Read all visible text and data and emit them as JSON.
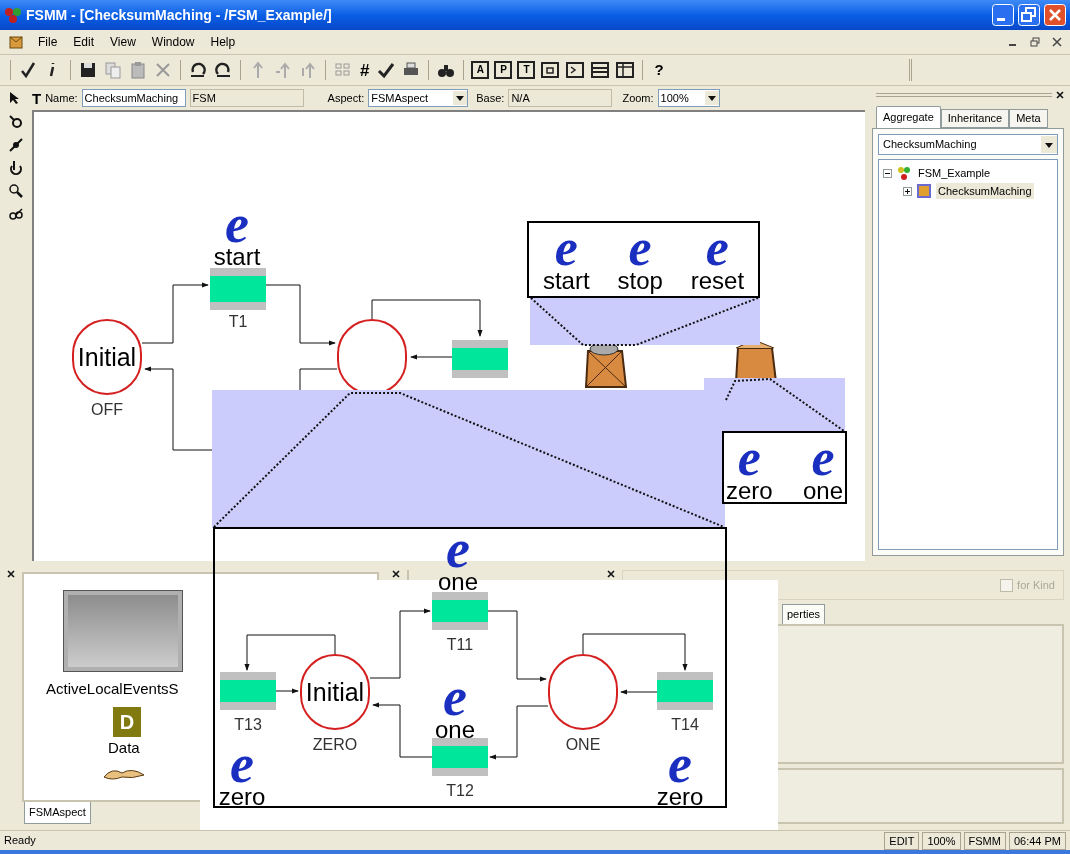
{
  "window": {
    "title": "FSMM - [ChecksumMaching - /FSM_Example/]"
  },
  "menu": [
    "File",
    "Edit",
    "View",
    "Window",
    "Help"
  ],
  "toolbar": {
    "grid_button": "#",
    "view_buttons": [
      "A",
      "P",
      "T"
    ],
    "help_button": "?"
  },
  "name_bar": {
    "tool_letter": "T",
    "name_label": "Name:",
    "name_value": "ChecksumMaching",
    "kind_value": "FSM",
    "aspect_label": "Aspect:",
    "aspect_value": "FSMAspect",
    "base_label": "Base:",
    "base_value": "N/A",
    "zoom_label": "Zoom:",
    "zoom_value": "100%"
  },
  "browser": {
    "tabs": [
      {
        "label": "Aggregate",
        "selected": true
      },
      {
        "label": "Inheritance",
        "selected": false
      },
      {
        "label": "Meta",
        "selected": false
      }
    ],
    "filter_value": "ChecksumMaching",
    "tree": [
      {
        "label": "FSM_Example",
        "expanded": true,
        "selected": false,
        "children": [
          {
            "label": "ChecksumMaching",
            "expanded": false,
            "selected": true
          }
        ]
      }
    ]
  },
  "diagram": {
    "states": [
      {
        "kind": "initial",
        "text": "Initial",
        "label": "OFF"
      },
      {
        "kind": "state"
      }
    ],
    "transitions": [
      {
        "kind": "labeled",
        "label": "T1"
      },
      {
        "kind": "unlabeled"
      }
    ],
    "events": [
      {
        "icon": "e",
        "name": "start"
      }
    ]
  },
  "callouts": [
    {
      "events": [
        {
          "icon": "e",
          "name": "start"
        },
        {
          "icon": "e",
          "name": "stop"
        },
        {
          "icon": "e",
          "name": "reset"
        }
      ]
    },
    {
      "events": [
        {
          "icon": "e",
          "name": "zero"
        },
        {
          "icon": "e",
          "name": "one"
        }
      ]
    }
  ],
  "inset": {
    "states": [
      {
        "kind": "initial",
        "text": "Initial",
        "label": "ZERO"
      },
      {
        "kind": "state",
        "label": "ONE"
      }
    ],
    "transitions": [
      {
        "kind": "labeled",
        "label": "T11"
      },
      {
        "kind": "labeled",
        "label": "T12"
      },
      {
        "kind": "labeled",
        "label": "T13"
      },
      {
        "kind": "labeled",
        "label": "T14"
      }
    ],
    "events": [
      {
        "icon": "e",
        "name": "one"
      },
      {
        "icon": "e",
        "name": "one"
      },
      {
        "icon": "e",
        "name": "zero"
      },
      {
        "icon": "e",
        "name": "zero"
      }
    ]
  },
  "parts_panel": {
    "items": [
      {
        "kind": "set",
        "label": "ActiveLocalEventsS"
      },
      {
        "kind": "data",
        "icon_letter": "D",
        "label": "Data"
      },
      {
        "kind": "hands"
      }
    ],
    "tabs": [
      {
        "label": "FSMAspect",
        "selected": true
      }
    ]
  },
  "attributes_panel": {
    "for_kind": {
      "label": "for Kind",
      "checked": false,
      "disabled": true
    },
    "tabs": [
      {
        "label": "perties",
        "selected": true
      }
    ]
  },
  "status_bar": {
    "message": "Ready",
    "panes": [
      "EDIT",
      "100%",
      "FSMM",
      "06:44 PM"
    ]
  }
}
